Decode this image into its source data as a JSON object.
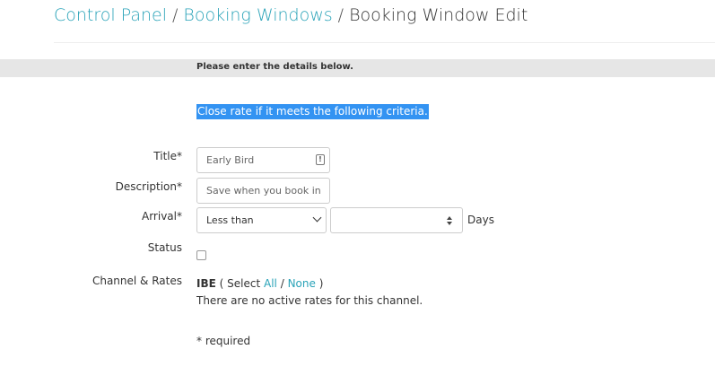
{
  "breadcrumb": {
    "items": [
      {
        "label": "Control Panel"
      },
      {
        "label": "Booking Windows"
      }
    ],
    "separator": "/",
    "current": "Booking Window Edit"
  },
  "notice": "Please enter the details below.",
  "criteria_text": "Close rate if it meets the following criteria.",
  "form": {
    "title_label": "Title*",
    "title_value": "Early Bird",
    "description_label": "Description*",
    "description_value": "Save when you book in",
    "arrival_label": "Arrival*",
    "arrival_selected": "Less than",
    "arrival_days_value": "",
    "days_unit": "Days",
    "status_label": "Status",
    "status_checked": false,
    "channel_label": "Channel & Rates",
    "channel_name": "IBE",
    "channel_select_prefix": "( Select",
    "channel_all": "All",
    "channel_slash": "/",
    "channel_none": "None",
    "channel_close": ")",
    "no_rates_text": "There are no active rates for this channel.",
    "required_note": "* required"
  },
  "colors": {
    "link": "#2aa3b8",
    "highlight": "#3393f2",
    "notice_bar": "#e6e6e6"
  },
  "icons": {
    "title_field_icon": "warning-icon",
    "arrival_select_icon": "chevron-down-icon",
    "days_spinner_icon": "spinner-arrows-icon"
  }
}
